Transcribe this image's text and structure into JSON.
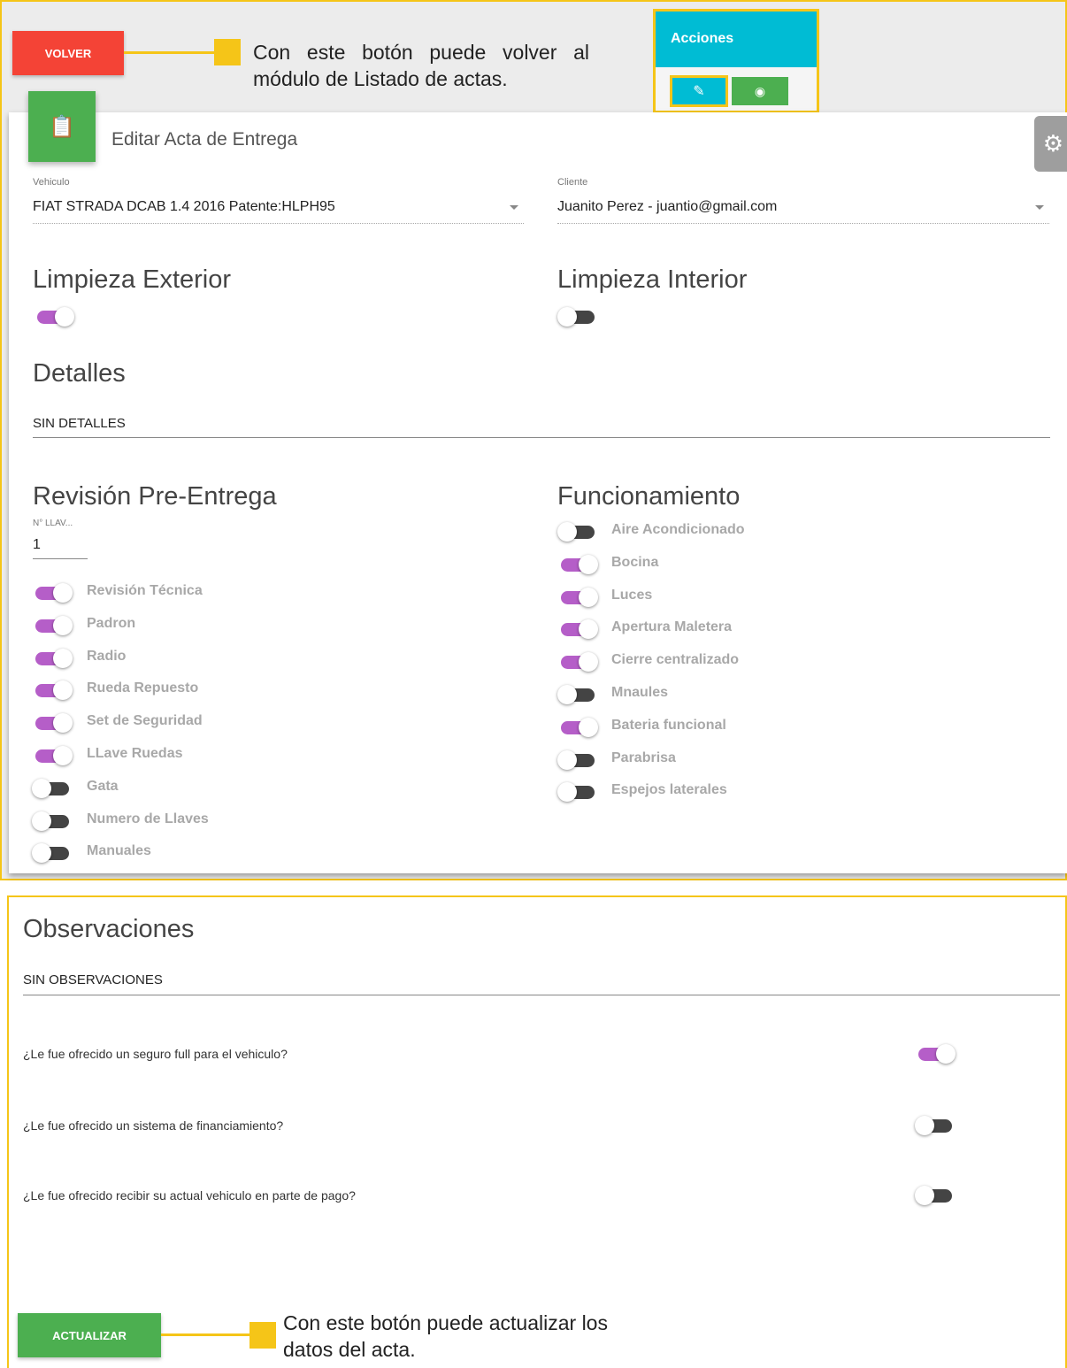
{
  "top": {
    "volver_label": "VOLVER",
    "callout_volver": "Con este botón puede volver al módulo de Listado de actas.",
    "acciones_title": "Acciones",
    "edit_icon": "pencil-icon",
    "view_icon": "eye-icon"
  },
  "card": {
    "title": "Editar Acta de Entrega",
    "icon": "clipboard-icon",
    "vehiculo_label": "Vehiculo",
    "vehiculo_value": "FIAT STRADA DCAB 1.4 2016 Patente:HLPH95",
    "cliente_label": "Cliente",
    "cliente_value": "Juanito Perez - juantio@gmail.com",
    "limpieza_exterior": {
      "label": "Limpieza Exterior",
      "on": true
    },
    "limpieza_interior": {
      "label": "Limpieza Interior",
      "on": false
    },
    "detalles_title": "Detalles",
    "detalles_value": "SIN DETALLES",
    "revision_title": "Revisión Pre-Entrega",
    "llaves_label": "N° LLAV...",
    "llaves_value": "1",
    "revision_items": [
      {
        "label": "Revisión Técnica",
        "on": true
      },
      {
        "label": "Padron",
        "on": true
      },
      {
        "label": "Radio",
        "on": true
      },
      {
        "label": "Rueda Repuesto",
        "on": true
      },
      {
        "label": "Set de Seguridad",
        "on": true
      },
      {
        "label": "LLave Ruedas",
        "on": true
      },
      {
        "label": "Gata",
        "on": false
      },
      {
        "label": "Numero de Llaves",
        "on": false
      },
      {
        "label": "Manuales",
        "on": false
      }
    ],
    "funcionamiento_title": "Funcionamiento",
    "funcionamiento_items": [
      {
        "label": "Aire Acondicionado",
        "on": false
      },
      {
        "label": "Bocina",
        "on": true
      },
      {
        "label": "Luces",
        "on": true
      },
      {
        "label": "Apertura Maletera",
        "on": true
      },
      {
        "label": "Cierre centralizado",
        "on": true
      },
      {
        "label": "Mnaules",
        "on": false
      },
      {
        "label": "Bateria funcional",
        "on": true
      },
      {
        "label": "Parabrisa",
        "on": false
      },
      {
        "label": "Espejos laterales",
        "on": false
      }
    ]
  },
  "bottom": {
    "observaciones_title": "Observaciones",
    "observaciones_value": "SIN OBSERVACIONES",
    "questions": [
      {
        "label": "¿Le fue ofrecido un seguro full para el vehiculo?",
        "on": true
      },
      {
        "label": "¿Le fue ofrecido un sistema de financiamiento?",
        "on": false
      },
      {
        "label": "¿Le fue ofrecido recibir su actual vehiculo en parte de pago?",
        "on": false
      }
    ],
    "actualizar_label": "ACTUALIZAR",
    "callout_actualizar": "Con este botón puede actualizar los datos del acta."
  },
  "colors": {
    "accent_yellow": "#f5c518",
    "toggle_on": "#b55ec8",
    "toggle_off": "#444444",
    "volver_red": "#f44336",
    "actualizar_green": "#4caf50",
    "acciones_cyan": "#00bcd4"
  }
}
